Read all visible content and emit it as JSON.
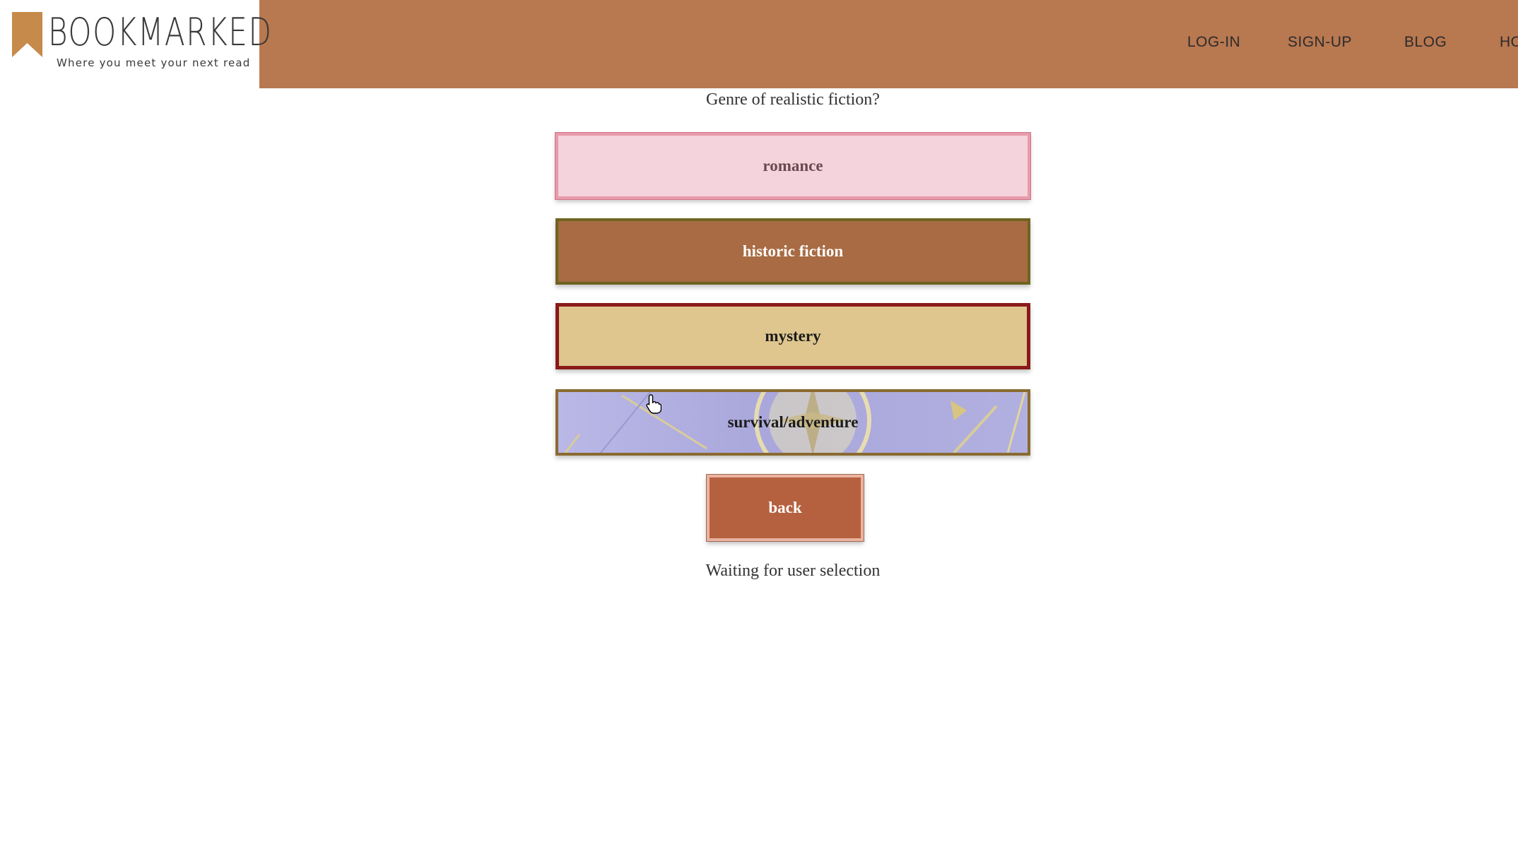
{
  "brand": {
    "name": "BOOKMARKED",
    "tagline": "Where you meet your next read",
    "color": "#b87850"
  },
  "nav": {
    "items": [
      "LOG-IN",
      "SIGN-UP",
      "BLOG",
      "HO"
    ]
  },
  "quiz": {
    "question": "Genre of realistic fiction?",
    "options": [
      "romance",
      "historic fiction",
      "mystery",
      "survival/adventure"
    ],
    "back_label": "back",
    "status": "Waiting for user selection"
  }
}
